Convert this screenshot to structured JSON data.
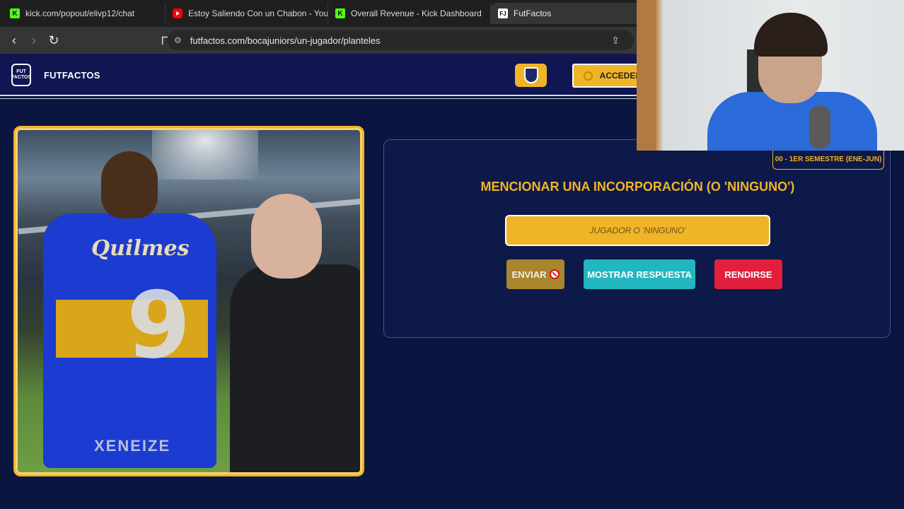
{
  "browser": {
    "tabs": [
      {
        "label": "kick.com/popout/elivp12/chat",
        "icon": "kick-icon"
      },
      {
        "label": "Estoy Saliendo Con un Chabon - You",
        "icon": "youtube-icon"
      },
      {
        "label": "Overall Revenue - Kick Dashboard",
        "icon": "kick-icon"
      },
      {
        "label": "FutFactos",
        "icon": "futfactos-icon"
      }
    ],
    "url": "futfactos.com/bocajuniors/un-jugador/planteles"
  },
  "site": {
    "logo_text": "FUT FACTOS",
    "brand": "FUTFACTOS",
    "login_label": "ACCEDER"
  },
  "photo": {
    "shirt_sponsor": "Quilmes",
    "shirt_number": "9",
    "shorts_text": "XENEIZE"
  },
  "game": {
    "season": "00 - 1ER SEMESTRE (ENE-JUN)",
    "question": "MENCIONAR UNA INCORPORACIÓN (O 'NINGUNO')",
    "answer_placeholder": "JUGADOR O 'NINGUNO'",
    "answer_value": "",
    "submit_label": "ENVIAR",
    "show_answer_label": "MOSTRAR RESPUESTA",
    "give_up_label": "RENDIRSE"
  },
  "colors": {
    "accent": "#f0b429",
    "background": "#0a1540",
    "show_answer": "#21b6c0",
    "give_up": "#e0203d"
  }
}
